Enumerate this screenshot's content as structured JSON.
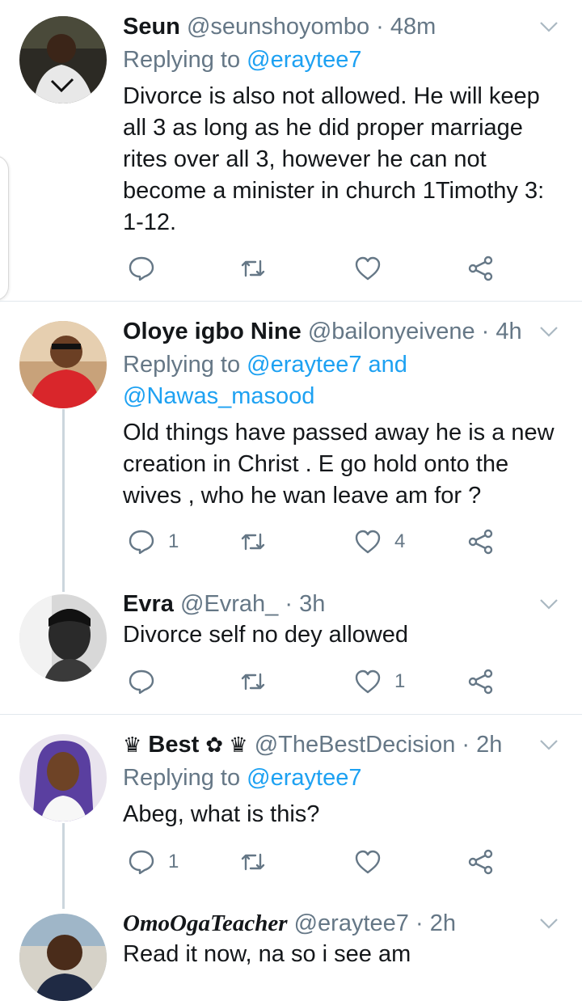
{
  "tweets": [
    {
      "name": "Seun",
      "handle": "@seunshoyombo",
      "time": "48m",
      "replying_prefix": "Replying to",
      "replying_to": "@eraytee7",
      "replying_extra": "",
      "replying_line2": "",
      "text": "Divorce is also not allowed. He will keep all 3 as long as he did proper marriage rites over all 3, however he can not become a minister in church 1Timothy 3: 1-12.",
      "replies": "",
      "retweets": "",
      "likes": ""
    },
    {
      "name": "Oloye igbo Nine",
      "handle": "@bailonyeivene",
      "time": "4h",
      "replying_prefix": "Replying to",
      "replying_to": "@eraytee7",
      "replying_extra": "and",
      "replying_line2": "@Nawas_masood",
      "text": "Old things have passed away he is a new creation in Christ . E go hold onto the wives , who he wan leave am for ?",
      "replies": "1",
      "retweets": "",
      "likes": "4"
    },
    {
      "name": "Evra",
      "handle": "@Evrah_",
      "time": "3h",
      "text": "Divorce self no dey allowed",
      "replies": "",
      "retweets": "",
      "likes": "1"
    },
    {
      "name_prefix": "♛",
      "name": "Best",
      "name_suffix": "✿ ♛",
      "handle": "@TheBestDecision",
      "time": "2h",
      "replying_prefix": "Replying to",
      "replying_to": "@eraytee7",
      "text": "Abeg, what is this?",
      "replies": "1",
      "retweets": "",
      "likes": ""
    },
    {
      "name": "OmoOgaTeacher",
      "handle": "@eraytee7",
      "time": "2h",
      "text": "Read it now, na so i see am"
    }
  ],
  "separator": "·",
  "icons": {
    "reply": "reply-icon",
    "retweet": "retweet-icon",
    "like": "heart-icon",
    "share": "share-icon",
    "menu": "chevron-down-icon"
  },
  "colors": {
    "link": "#1da1f2",
    "secondary": "#657786",
    "divider": "#e1e8ed",
    "thread_line": "#ccd6dd"
  }
}
